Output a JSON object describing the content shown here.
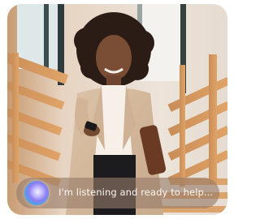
{
  "assistant": {
    "status_text": "I'm listening and ready to help..."
  },
  "image": {
    "subject_icon": "woman-with-phone-photo"
  },
  "colors": {
    "bar_background": "#9a7b67",
    "bar_text": "#fbf6f1",
    "orb_primary": "#8b7cf2"
  }
}
